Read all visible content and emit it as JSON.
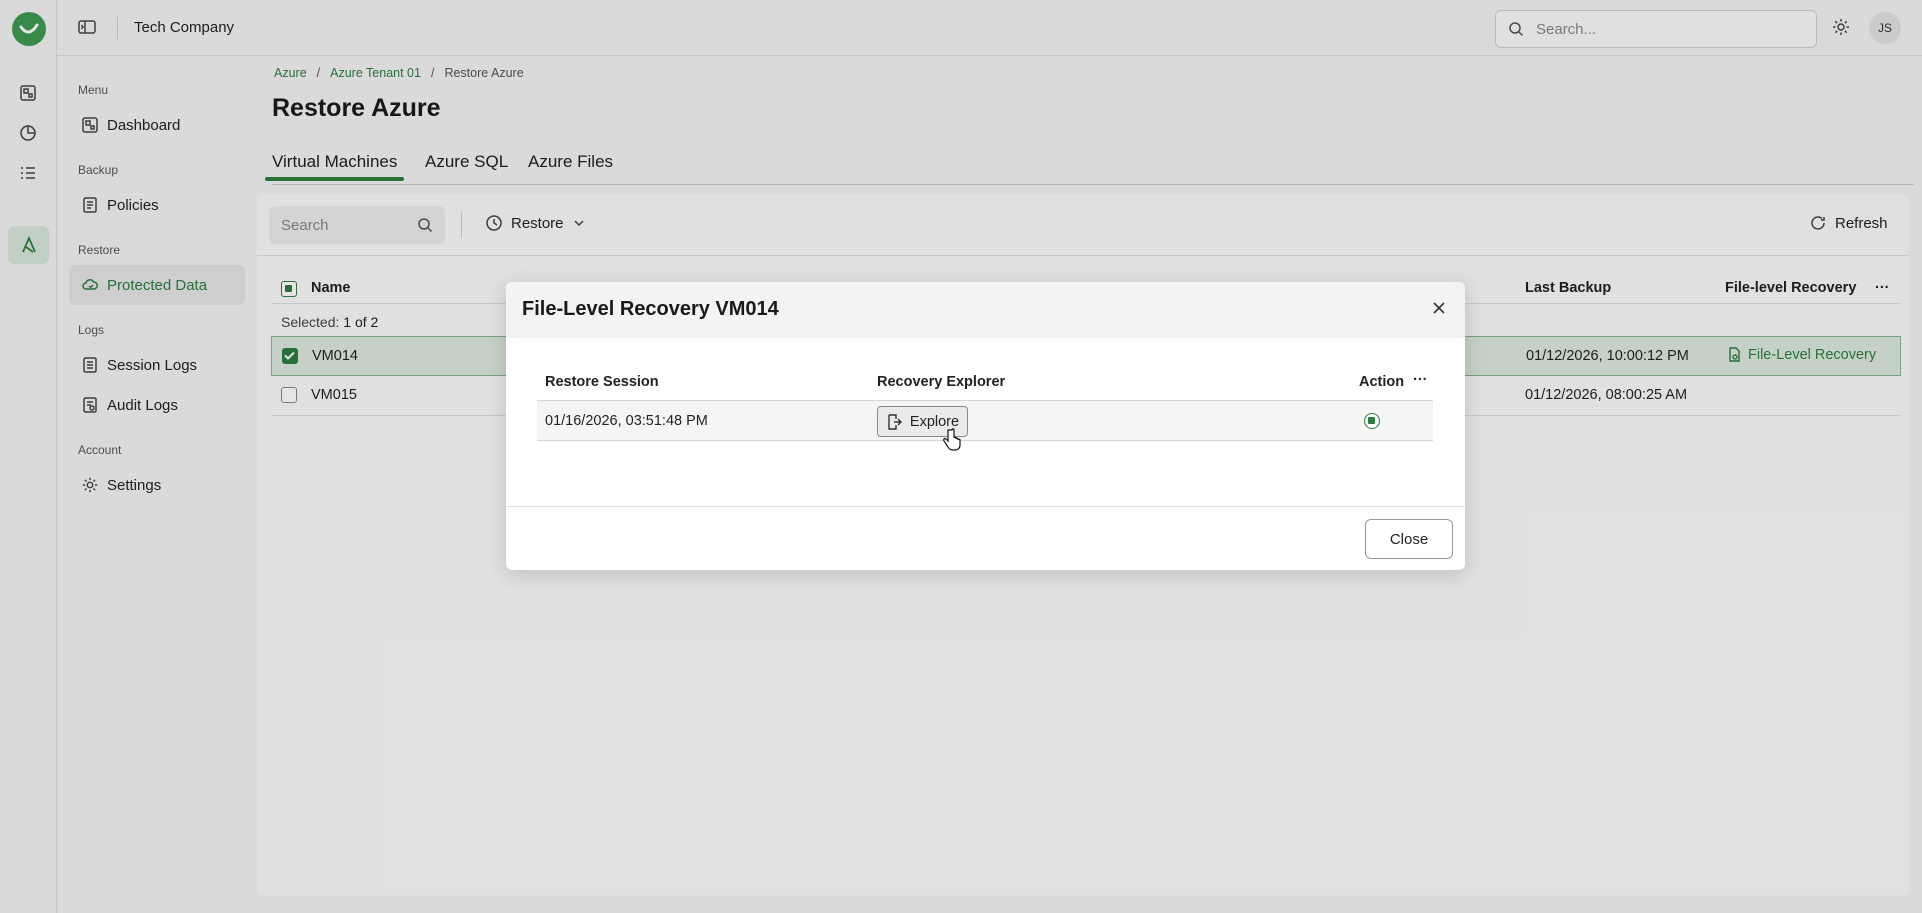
{
  "topbar": {
    "company": "Tech Company",
    "search_placeholder": "Search...",
    "avatar_initials": "JS"
  },
  "sidebar": {
    "sections": [
      {
        "label": "Menu",
        "items": [
          {
            "label": "Dashboard",
            "icon": "dashboard-icon"
          }
        ]
      },
      {
        "label": "Backup",
        "items": [
          {
            "label": "Policies",
            "icon": "policy-icon"
          }
        ]
      },
      {
        "label": "Restore",
        "items": [
          {
            "label": "Protected Data",
            "icon": "cloud-shield-icon",
            "active": true
          }
        ]
      },
      {
        "label": "Logs",
        "items": [
          {
            "label": "Session Logs",
            "icon": "log-icon"
          },
          {
            "label": "Audit Logs",
            "icon": "audit-icon"
          }
        ]
      },
      {
        "label": "Account",
        "items": [
          {
            "label": "Settings",
            "icon": "gear-icon"
          }
        ]
      }
    ]
  },
  "breadcrumb": [
    "Azure",
    "Azure Tenant 01",
    "Restore Azure"
  ],
  "page_title": "Restore Azure",
  "tabs": [
    "Virtual Machines",
    "Azure SQL",
    "Azure Files"
  ],
  "toolbar": {
    "search_placeholder": "Search",
    "restore_label": "Restore",
    "refresh_label": "Refresh"
  },
  "table": {
    "columns": [
      "Name",
      "Last Backup",
      "File-level Recovery"
    ],
    "selected_label": "Selected:",
    "selected_count": "1 of 2",
    "rows": [
      {
        "name": "VM014",
        "last_backup": "01/12/2026, 10:00:12 PM",
        "flr": "File-Level Recovery",
        "selected": true
      },
      {
        "name": "VM015",
        "last_backup": "01/12/2026, 08:00:25 AM",
        "flr": "",
        "selected": false
      }
    ]
  },
  "modal": {
    "title": "File-Level Recovery VM014",
    "columns": [
      "Restore Session",
      "Recovery Explorer",
      "Action"
    ],
    "row": {
      "session": "01/16/2026, 03:51:48 PM",
      "explore_label": "Explore"
    },
    "close_label": "Close"
  },
  "colors": {
    "accent": "#2e7d3e",
    "selected_row": "#dce9de"
  }
}
